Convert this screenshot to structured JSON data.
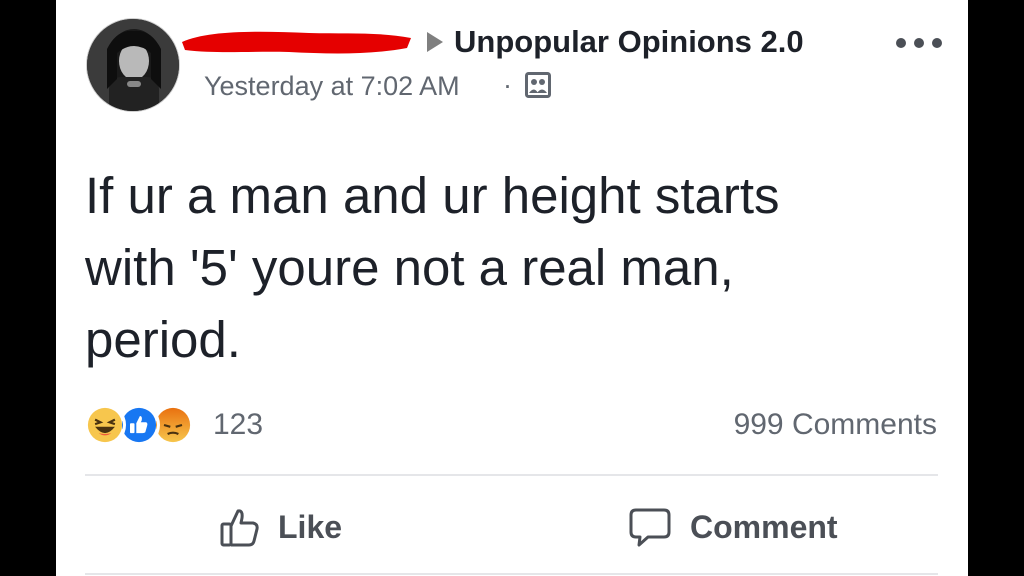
{
  "post": {
    "group_name": "Unpopular Opinions 2.0",
    "timestamp": "Yesterday at 7:02 AM",
    "separator": "·",
    "audience_icon": "group-audience-icon",
    "body": "If ur a man and ur height starts\nwith '5' youre not a real man,\nperiod.",
    "reaction_count": "123",
    "comment_count": "999 Comments",
    "reactions": [
      "haha-icon",
      "like-icon",
      "angry-icon"
    ]
  },
  "actions": {
    "like_label": "Like",
    "comment_label": "Comment"
  },
  "colors": {
    "text": "#1d2129",
    "secondary": "#616770",
    "like_blue": "#1877f2",
    "haha_yellow": "#f7c64d",
    "angry_orange": "#e9710f",
    "redaction": "#e50000"
  }
}
